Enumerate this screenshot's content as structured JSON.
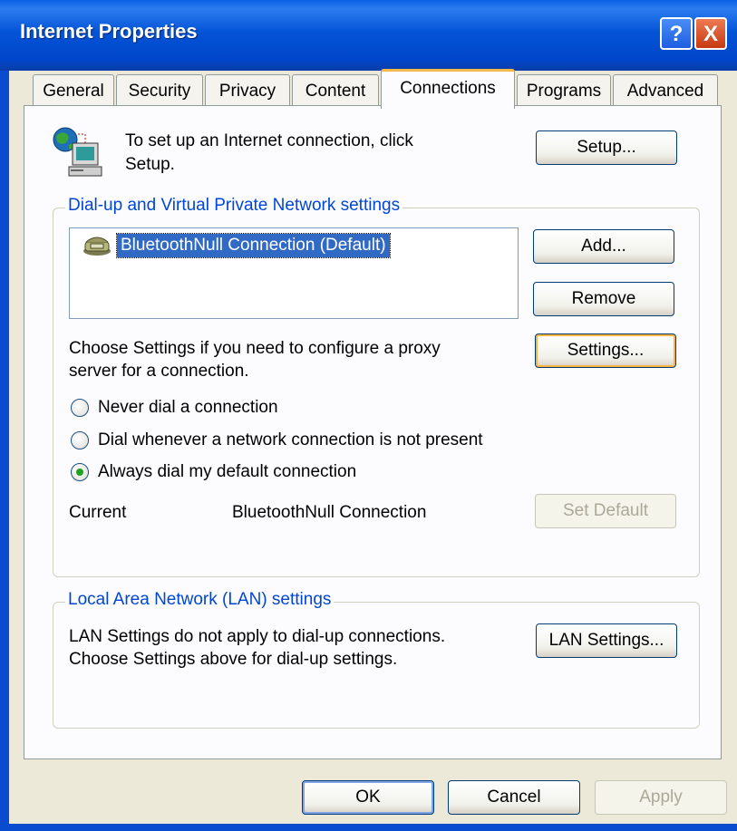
{
  "window": {
    "title": "Internet Properties",
    "help_label": "?",
    "close_label": "X"
  },
  "tabs": [
    {
      "label": "General",
      "active": false
    },
    {
      "label": "Security",
      "active": false
    },
    {
      "label": "Privacy",
      "active": false
    },
    {
      "label": "Content",
      "active": false
    },
    {
      "label": "Connections",
      "active": true
    },
    {
      "label": "Programs",
      "active": false
    },
    {
      "label": "Advanced",
      "active": false
    }
  ],
  "setup": {
    "line1": "To set up an Internet connection, click",
    "line2": "Setup.",
    "button": "Setup..."
  },
  "dialup": {
    "group_label": "Dial-up and Virtual Private Network settings",
    "connections": [
      "BluetoothNull Connection (Default)"
    ],
    "add_button": "Add...",
    "remove_button": "Remove",
    "settings_line1": "Choose Settings if you need to configure a proxy",
    "settings_line2": "server for a connection.",
    "settings_button": "Settings...",
    "radio_never": "Never dial a connection",
    "radio_whenever": "Dial whenever a network connection is not present",
    "radio_always": "Always dial my default connection",
    "selected_radio": "always",
    "current_label": "Current",
    "current_value": "BluetoothNull Connection",
    "set_default_button": "Set Default"
  },
  "lan": {
    "group_label": "Local Area Network (LAN) settings",
    "line1": "LAN Settings do not apply to dial-up connections.",
    "line2": "Choose Settings above for dial-up settings.",
    "button": "LAN Settings..."
  },
  "footer": {
    "ok": "OK",
    "cancel": "Cancel",
    "apply": "Apply"
  },
  "icons": {
    "setup": "network-globe-computer-icon",
    "connection": "dialup-phone-icon",
    "accent": "#0046d5"
  }
}
